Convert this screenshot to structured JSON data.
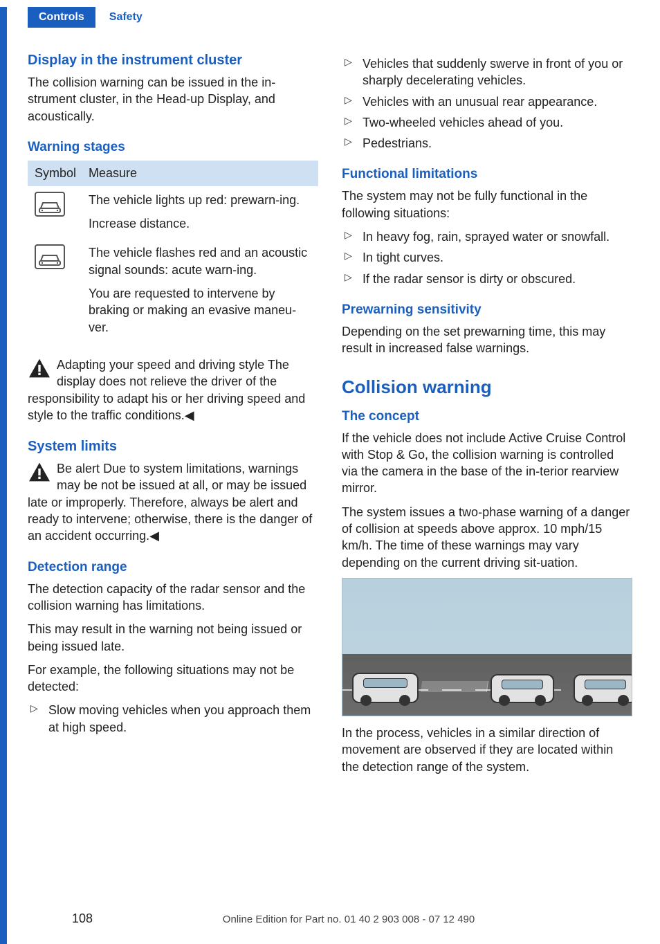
{
  "tabs": {
    "primary": "Controls",
    "secondary": "Safety"
  },
  "left": {
    "h_display": "Display in the instrument cluster",
    "p_display": "The collision warning can be issued in the in‐strument cluster, in the Head-up Display, and acoustically.",
    "h_stages": "Warning stages",
    "table": {
      "th_symbol": "Symbol",
      "th_measure": "Measure",
      "row1_a": "The vehicle lights up red: prewarn‐ing.",
      "row1_b": "Increase distance.",
      "row2_a": "The vehicle flashes red and an acoustic signal sounds: acute warn‐ing.",
      "row2_b": "You are requested to intervene by braking or making an evasive maneu‐ver."
    },
    "warn1_title": "Adapting your speed and driving style",
    "warn1_body": "The display does not relieve the driver of the responsibility to adapt his or her driving speed and style to the traffic conditions.◀",
    "h_limits": "System limits",
    "warn2_title": "Be alert",
    "warn2_body": "Due to system limitations, warnings may be not be issued at all, or may be issued late or improperly. Therefore, always be alert and ready to intervene; otherwise, there is the danger of an accident occurring.◀",
    "h_detect": "Detection range",
    "p_detect1": "The detection capacity of the radar sensor and the collision warning has limitations.",
    "p_detect2": "This may result in the warning not being issued or being issued late.",
    "p_detect3": "For example, the following situations may not be detected:",
    "detect_list": {
      "i0": "Slow moving vehicles when you approach them at high speed."
    }
  },
  "right": {
    "detect_list": {
      "i0": "Vehicles that suddenly swerve in front of you or sharply decelerating vehicles.",
      "i1": "Vehicles with an unusual rear appearance.",
      "i2": "Two-wheeled vehicles ahead of you.",
      "i3": "Pedestrians."
    },
    "h_func": "Functional limitations",
    "p_func": "The system may not be fully functional in the following situations:",
    "func_list": {
      "i0": "In heavy fog, rain, sprayed water or snowfall.",
      "i1": "In tight curves.",
      "i2": "If the radar sensor is dirty or obscured."
    },
    "h_prewarn": "Prewarning sensitivity",
    "p_prewarn": "Depending on the set prewarning time, this may result in increased false warnings.",
    "h_collision": "Collision warning",
    "h_concept": "The concept",
    "p_concept1": "If the vehicle does not include Active Cruise Control with Stop & Go, the collision warning is controlled via the camera in the base of the in‐terior rearview mirror.",
    "p_concept2": "The system issues a two-phase warning of a danger of collision at speeds above approx. 10 mph/15 km/h. The time of these warnings may vary depending on the current driving sit‐uation.",
    "p_after_img": "In the process, vehicles in a similar direction of movement are observed if they are located within the detection range of the system."
  },
  "footer": {
    "page": "108",
    "text": "Online Edition for Part no. 01 40 2 903 008 - 07 12 490"
  }
}
